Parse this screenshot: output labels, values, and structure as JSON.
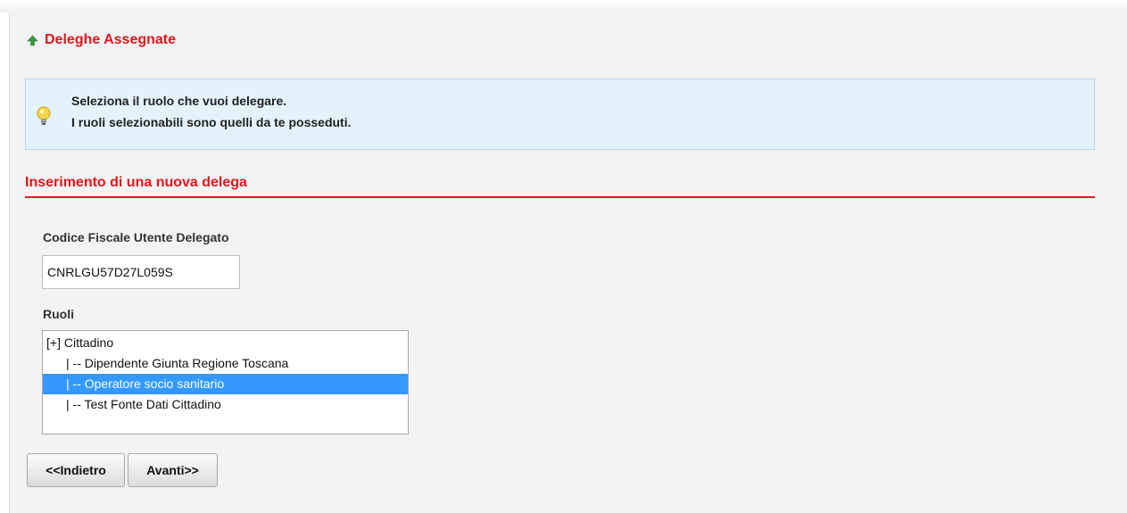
{
  "header": {
    "title": "Deleghe Assegnate",
    "icon": "up-arrow-icon"
  },
  "info": {
    "icon": "lightbulb-icon",
    "line1": "Seleziona il ruolo che vuoi delegare.",
    "line2": "I ruoli selezionabili sono quelli da te posseduti."
  },
  "section": {
    "title": "Inserimento di una nuova delega"
  },
  "form": {
    "cf_label": "Codice Fiscale Utente Delegato",
    "cf_value": "CNRLGU57D27L059S",
    "roles_label": "Ruoli",
    "roles": [
      {
        "label": "[+] Cittadino",
        "selected": false
      },
      {
        "label": "| -- Dipendente Giunta Regione Toscana",
        "selected": false
      },
      {
        "label": "| -- Operatore socio sanitario",
        "selected": true
      },
      {
        "label": "| -- Test Fonte Dati Cittadino",
        "selected": false
      }
    ]
  },
  "buttons": {
    "back": "<<Indietro",
    "next": "Avanti>>"
  },
  "colors": {
    "accent_red": "#e2161d",
    "info_bg": "#e4f2fb",
    "selection": "#3399ff",
    "arrow_green": "#3a9a3a"
  }
}
